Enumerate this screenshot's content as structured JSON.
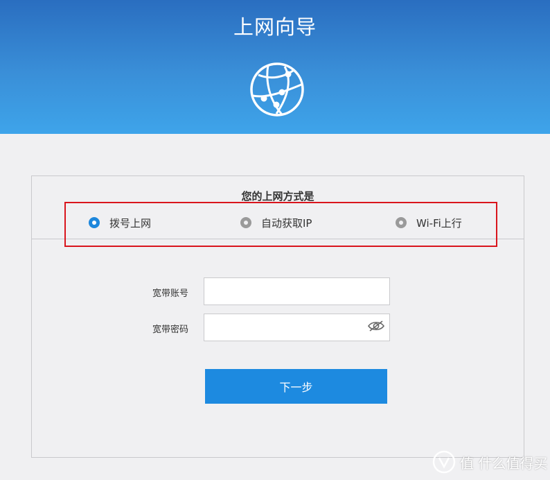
{
  "header": {
    "title": "上网向导"
  },
  "wizard": {
    "question": "您的上网方式是",
    "modes": [
      {
        "label": "拨号上网",
        "selected": true
      },
      {
        "label": "自动获取IP",
        "selected": false
      },
      {
        "label": "Wi-Fi上行",
        "selected": false
      }
    ],
    "fields": {
      "account_label": "宽带账号",
      "account_value": "",
      "password_label": "宽带密码",
      "password_value": ""
    },
    "next_label": "下一步"
  },
  "watermark": {
    "text": "值 什么值得买"
  },
  "colors": {
    "accent": "#1d8ae0",
    "highlight_border": "#d9141c",
    "header_top": "#2a6ec0",
    "header_bottom": "#3ea4ea"
  }
}
